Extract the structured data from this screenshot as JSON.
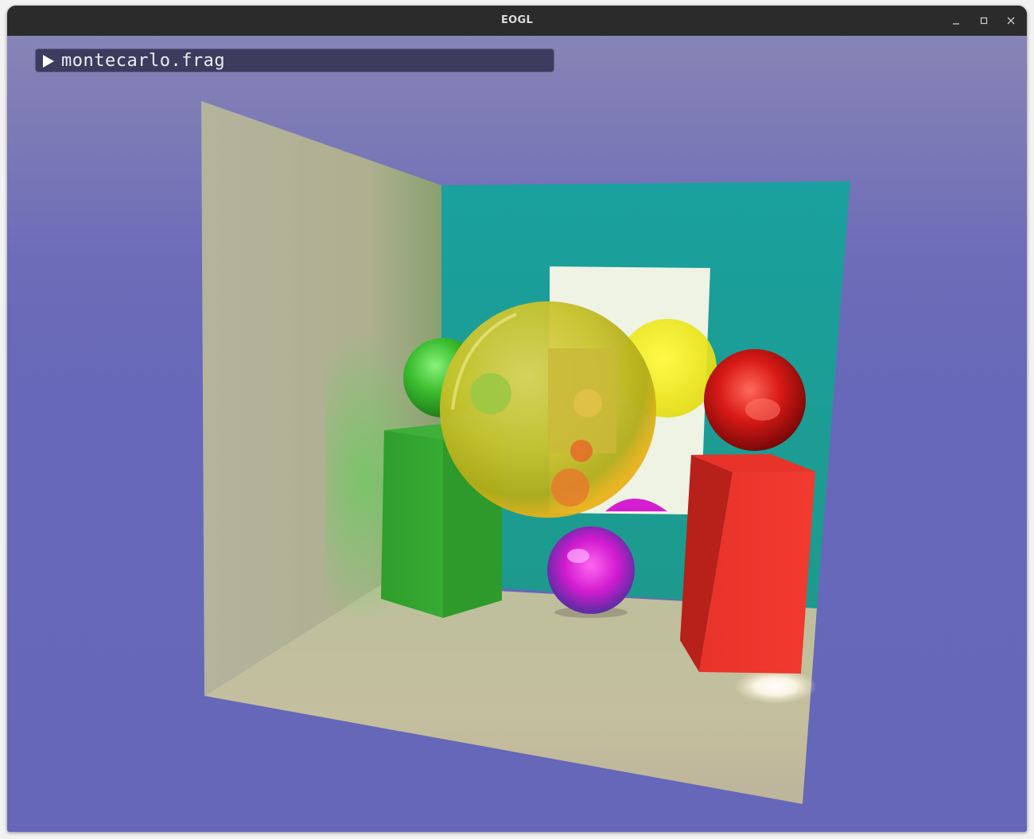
{
  "window": {
    "title": "EOGL",
    "controls": {
      "minimize_icon": "minimize-icon",
      "maximize_icon": "maximize-icon",
      "close_icon": "close-icon"
    }
  },
  "shader_panel": {
    "label": "montecarlo.frag",
    "toggle_icon": "play-triangle-icon",
    "collapsed": true
  },
  "scene": {
    "description_icon": "cornell-box-render",
    "colors": {
      "background": "#6667b9",
      "left_wall": "#b6b398",
      "back_wall": "#1c9c98",
      "floor": "#c8c1a2",
      "green_block": "#33a431",
      "red_block": "#e2332b",
      "glass_sphere": "#d8c628",
      "green_sphere": "#3dbf2e",
      "red_sphere": "#d21a16",
      "magenta_sphere": "#d21bd0",
      "mirror": "#f1f5ea"
    }
  }
}
